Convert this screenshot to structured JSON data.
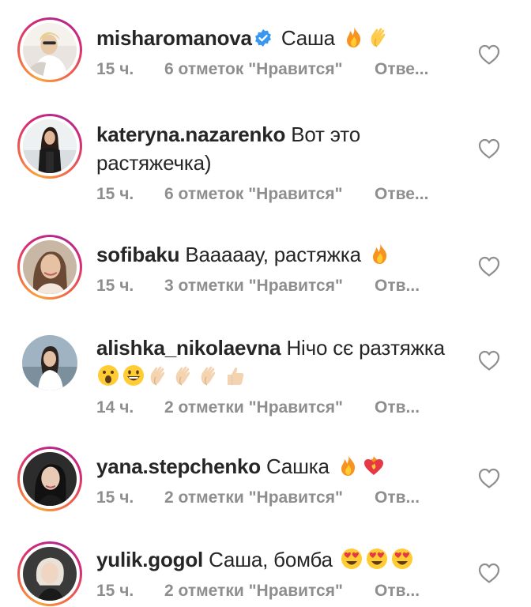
{
  "comments": [
    {
      "username": "misharomanova",
      "verified": true,
      "text": "Саша",
      "emojis": [
        "fire-emoji",
        "clapping-hands-emoji"
      ],
      "time": "15 ч.",
      "likes": "6 отметок \"Нравится\"",
      "reply": "Отве..."
    },
    {
      "username": "kateryna.nazarenko",
      "verified": false,
      "text": "Вот это растяжечка)",
      "emojis": [],
      "time": "15 ч.",
      "likes": "6 отметок \"Нравится\"",
      "reply": "Отве..."
    },
    {
      "username": "sofibaku",
      "verified": false,
      "text": "Вааааау, растяжка",
      "emojis": [
        "fire-emoji"
      ],
      "time": "15 ч.",
      "likes": "3 отметки \"Нравится\"",
      "reply": "Отв..."
    },
    {
      "username": "alishka_nikolaevna",
      "verified": false,
      "text": "Нічо сє разтяжка",
      "emojis": [
        "astonished-face-emoji",
        "grinning-face-emoji",
        "clapping-hands-emoji",
        "clapping-hands-emoji",
        "clapping-hands-emoji",
        "thumbs-up-emoji"
      ],
      "time": "14 ч.",
      "likes": "2 отметки \"Нравится\"",
      "reply": "Отв..."
    },
    {
      "username": "yana.stepchenko",
      "verified": false,
      "text": "Сашка",
      "emojis": [
        "fire-emoji",
        "heart-on-fire-emoji"
      ],
      "time": "15 ч.",
      "likes": "2 отметки \"Нравится\"",
      "reply": "Отв..."
    },
    {
      "username": "yulik.gogol",
      "verified": false,
      "text": "Саша, бомба",
      "emojis": [
        "heart-eyes-emoji",
        "heart-eyes-emoji",
        "heart-eyes-emoji"
      ],
      "time": "15 ч.",
      "likes": "2 отметки \"Нравится\"",
      "reply": "Отв..."
    }
  ],
  "colors": {
    "text": "#262626",
    "meta": "#8e8e8e",
    "verified": "#3897f0",
    "story_ring_start": "#f9a23b",
    "story_ring_end": "#d62976"
  }
}
